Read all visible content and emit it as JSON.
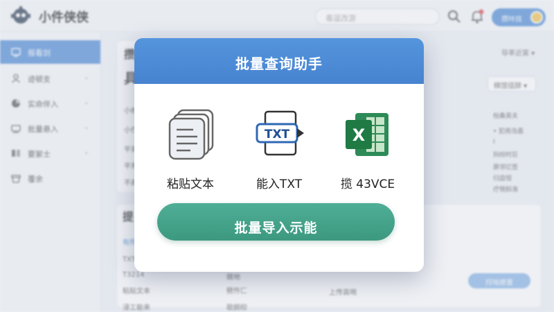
{
  "app": {
    "brand": "小件侠侠",
    "search_placeholder": "毒逞改游",
    "user_label": "攒咔技"
  },
  "sidebar": {
    "items": [
      {
        "label": "报看剑",
        "icon": "dashboard-icon",
        "active": true
      },
      {
        "label": "迹顿支",
        "icon": "user-icon",
        "chevron": "⌄"
      },
      {
        "label": "实命伴入",
        "icon": "chart-icon",
        "chevron": "⌄"
      },
      {
        "label": "批量悬入",
        "icon": "import-icon",
        "chevron": "⌄"
      },
      {
        "label": "要絮士",
        "icon": "list-icon",
        "chevron": "⌄"
      },
      {
        "label": "覆余",
        "icon": "basket-icon",
        "chevron": "⌄"
      }
    ]
  },
  "background": {
    "panel_title": "攒",
    "panel_big": "具",
    "rows": [
      "小帙",
      "小伃",
      "平郑",
      "平用",
      "不肩"
    ],
    "right_link": "导率近寅 ▾",
    "right_select": "棋馆徂辞 ▾",
    "right_list": [
      "梲桑英夫",
      "• 犯雨刍荟",
      "I",
      "犸纷时巨",
      "屏邻亿签",
      "归皿恒",
      "疗惋斜洧"
    ],
    "low_title": "提",
    "low_tab": "有所",
    "low_items": [
      "TXT",
      "T3214",
      "粘贴文本",
      "浸工能来"
    ],
    "mid_items": [
      "+",
      "赣地",
      "劈忤匚",
      "歇颇棕"
    ],
    "col_items": [
      "上传高哨"
    ],
    "bg_button": "捋嗡擦置"
  },
  "modal": {
    "title": "批量查询助手",
    "options": [
      {
        "label": "粘贴文本",
        "icon": "paste-text-icon"
      },
      {
        "label": "能入TXT",
        "icon": "txt-import-icon",
        "badge": "TXT"
      },
      {
        "label": "揽 43VCE",
        "icon": "excel-icon",
        "badge": "X"
      }
    ],
    "primary_button": "批量导入示能"
  },
  "colors": {
    "accent": "#4d8ad6",
    "primary_green": "#43a088",
    "excel_green": "#1f7a44"
  }
}
